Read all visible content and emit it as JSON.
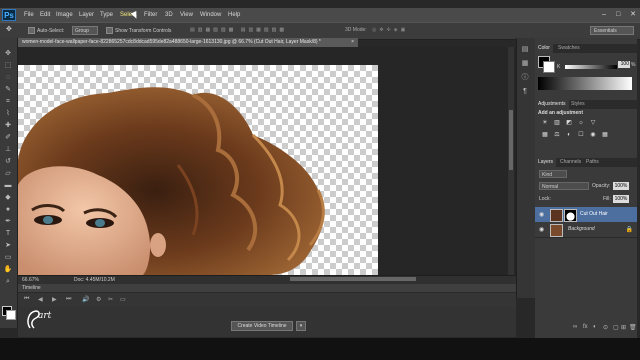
{
  "app": {
    "logo_text": "Ps"
  },
  "menu": [
    "File",
    "Edit",
    "Image",
    "Layer",
    "Type",
    "Select",
    "Filter",
    "3D",
    "View",
    "Window",
    "Help"
  ],
  "window_controls": [
    "–",
    "□",
    "✕"
  ],
  "options_bar": {
    "auto_select_label": "Auto-Select:",
    "auto_select_value": "Group",
    "show_transform_label": "Show Transform Controls",
    "mode_3d_label": "3D Mode:",
    "workspace": "Essentials"
  },
  "document": {
    "tab_title": "women-model-face-wallpaper-face-822865257cdc8ddcad595de82a488650-large-1613130.jpg @ 66.7% (Cut Out Hair, Layer Mask/8) *",
    "close_glyph": "×",
    "zoom": "66.67%",
    "doc_size": "Doc: 4.45M/10.2M"
  },
  "timeline": {
    "title": "Timeline",
    "create_button": "Create Video Timeline",
    "controls": [
      "⏮",
      "◀",
      "▶",
      "⏭",
      "🔊",
      "⚙",
      "✂",
      "▭"
    ]
  },
  "color_panel": {
    "tabs": [
      "Color",
      "Swatches"
    ],
    "channel_label": "K",
    "k_value": "100",
    "unit": "%"
  },
  "adjustments_panel": {
    "tabs": [
      "Adjustments",
      "Styles"
    ],
    "heading": "Add an adjustment",
    "icons_row1": [
      "☀",
      "▥",
      "◩",
      "☼",
      "▽"
    ],
    "icons_row2": [
      "▦",
      "⚖",
      "◐",
      "☐",
      "◉",
      "▦"
    ]
  },
  "layers_panel": {
    "tabs": [
      "Layers",
      "Channels",
      "Paths"
    ],
    "kind": "Kind",
    "blend_mode": "Normal",
    "opacity_label": "Opacity:",
    "opacity": "100%",
    "lock_label": "Lock:",
    "fill_label": "Fill:",
    "fill": "100%",
    "layers": [
      {
        "name": "Cut Out Hair",
        "selected": true
      },
      {
        "name": "Background",
        "selected": false
      }
    ],
    "bottom_icons": [
      "∞",
      "fx",
      "◐",
      "⊙",
      "▢",
      "⊞",
      "🗑"
    ]
  },
  "watermark_text": "art",
  "colors": {
    "selection_blue": "#4d6fa0",
    "ps_blue": "#49b1ff"
  }
}
